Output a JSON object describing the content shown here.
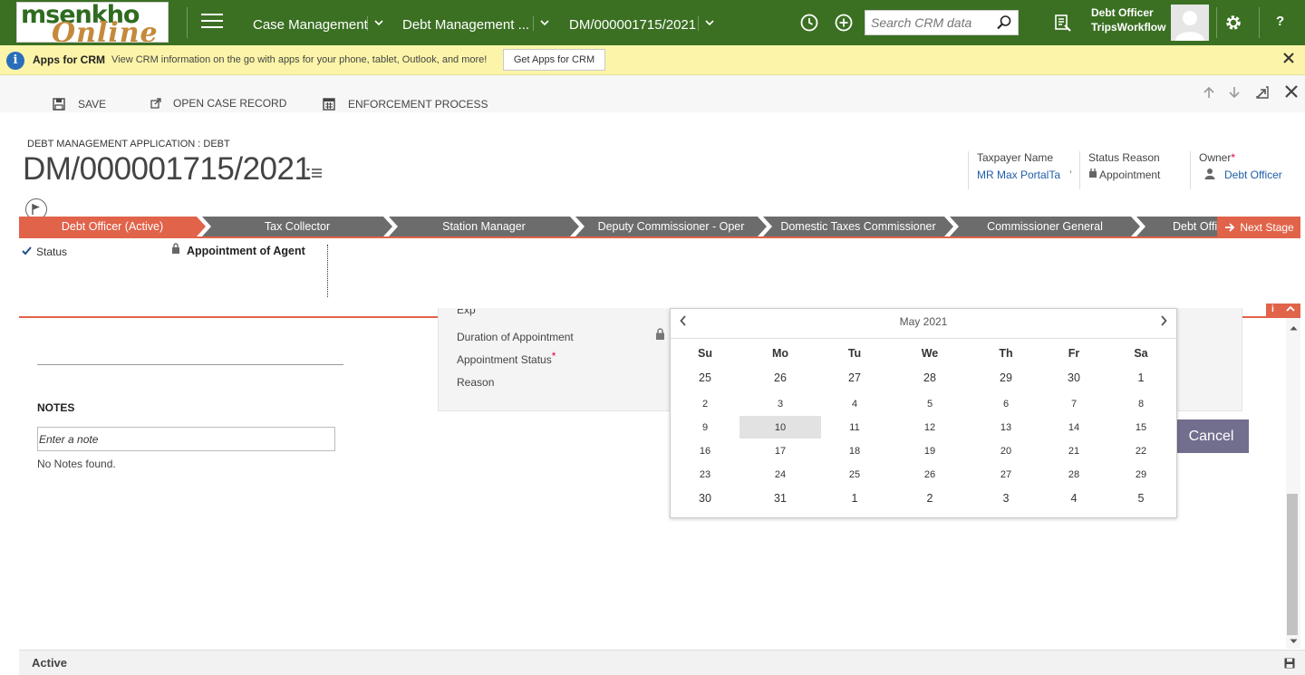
{
  "logo": {
    "line1": "msenkho",
    "line2": "Online"
  },
  "nav": {
    "area": "Case Management",
    "entity": "Debt Management ...",
    "record": "DM/000001715/2021",
    "search_placeholder": "Search CRM data",
    "user_name": "Debt Officer",
    "user_org": "TripsWorkflow",
    "help": "?"
  },
  "notification": {
    "title": "Apps for CRM",
    "message": "View CRM information on the go with apps for your phone, tablet, Outlook, and more!",
    "button": "Get Apps for CRM"
  },
  "commands": {
    "save": "SAVE",
    "open_case": "OPEN CASE RECORD",
    "enforcement": "ENFORCEMENT PROCESS"
  },
  "header": {
    "entity_type": "DEBT MANAGEMENT APPLICATION : DEBT",
    "title": "DM/000001715/2021",
    "fields": {
      "taxpayer_label": "Taxpayer Name",
      "taxpayer_value": "MR Max PortalTa",
      "taxpayer_more": "’",
      "status_reason_label": "Status Reason",
      "status_reason_value": "Appointment",
      "owner_label": "Owner",
      "owner_value": "Debt Officer"
    }
  },
  "process": {
    "stages": [
      "Debt Officer (Active)",
      "Tax Collector",
      "Station Manager",
      "Deputy Commissioner - Oper",
      "Domestic Taxes Commissioner",
      "Commissioner General",
      "Debt Offi"
    ],
    "next_stage": "Next Stage",
    "step_label": "Status",
    "step_value": "Appointment of Agent",
    "collapse_info": "i",
    "collapse_up": "^"
  },
  "notes": {
    "title": "NOTES",
    "placeholder": "Enter a note",
    "empty": "No Notes found."
  },
  "dialog": {
    "fields": [
      "Duration of Appointment",
      "Appointment Status",
      "Reason"
    ],
    "cancel": "Cancel"
  },
  "calendar": {
    "month": "May 2021",
    "weekdays": [
      "Su",
      "Mo",
      "Tu",
      "We",
      "Th",
      "Fr",
      "Sa"
    ],
    "weeks": [
      [
        "25",
        "26",
        "27",
        "28",
        "29",
        "30",
        "1"
      ],
      [
        "2",
        "3",
        "4",
        "5",
        "6",
        "7",
        "8"
      ],
      [
        "9",
        "10",
        "11",
        "12",
        "13",
        "14",
        "15"
      ],
      [
        "16",
        "17",
        "18",
        "19",
        "20",
        "21",
        "22"
      ],
      [
        "23",
        "24",
        "25",
        "26",
        "27",
        "28",
        "29"
      ],
      [
        "30",
        "31",
        "1",
        "2",
        "3",
        "4",
        "5"
      ]
    ],
    "highlighted": "10"
  },
  "footer": {
    "status": "Active"
  },
  "colors": {
    "nav_green": "#3b7023",
    "stage_active": "#e0634a",
    "stage_inactive": "#6c6c6c",
    "cancel": "#726e8e",
    "link": "#1f5fa8"
  }
}
